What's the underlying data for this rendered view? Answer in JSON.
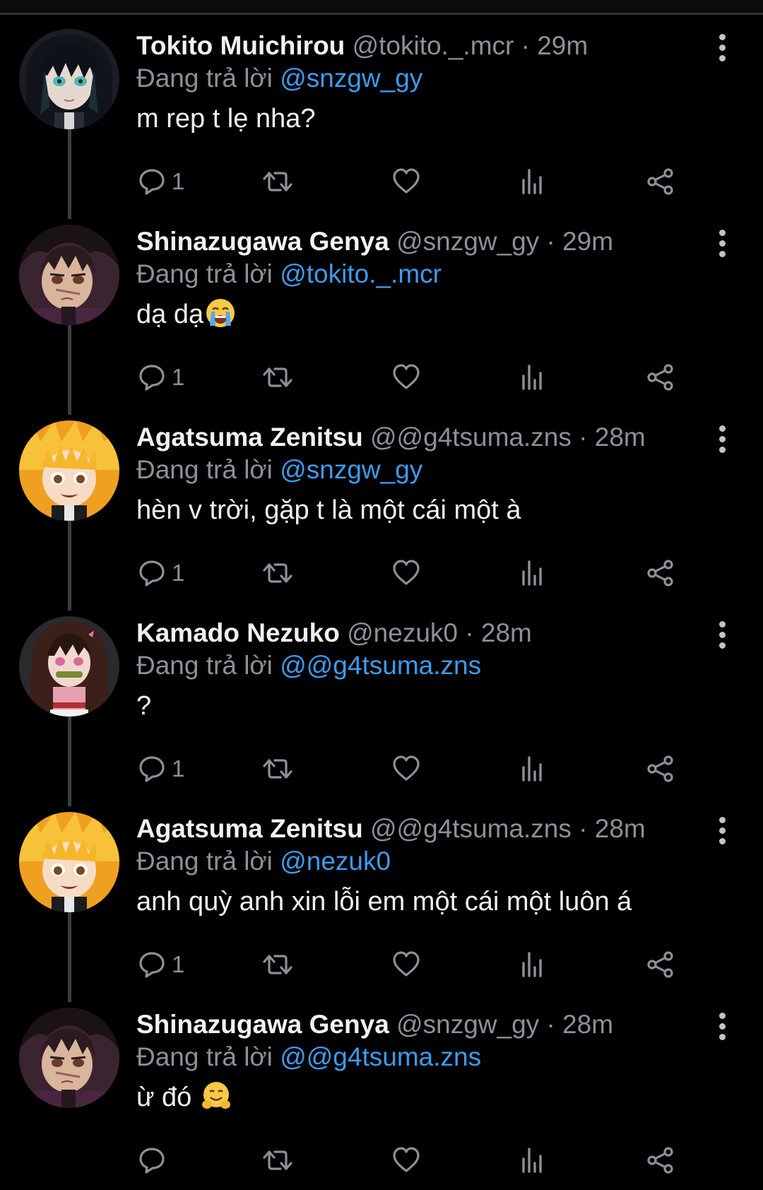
{
  "reply_prefix": "Đang trả lời",
  "colors": {
    "background": "#000000",
    "mention": "#3e9bed",
    "muted": "#8b9198",
    "text": "#f0f0f0",
    "icon": "#8b9198"
  },
  "icons": {
    "reply": "reply-bubble-icon",
    "retweet": "retweet-icon",
    "like": "heart-icon",
    "views": "analytics-bars-icon",
    "share": "share-icon",
    "more": "more-vertical-icon"
  },
  "tweets": [
    {
      "name": "Tokito Muichirou",
      "handle": "@tokito._.mcr",
      "dot": "·",
      "time": "29m",
      "reply_to": "@snzgw_gy",
      "text": "m rep t lẹ nha?",
      "emoji": "",
      "reply_count": "1"
    },
    {
      "name": "Shinazugawa Genya",
      "handle": "@snzgw_gy",
      "dot": "·",
      "time": "29m",
      "reply_to": "@tokito._.mcr",
      "text": "dạ dạ",
      "emoji": "crying-face",
      "reply_count": "1"
    },
    {
      "name": "Agatsuma Zenitsu",
      "handle": "@@g4tsuma.zns",
      "dot": "·",
      "time": "28m",
      "reply_to": "@snzgw_gy",
      "text": "hèn v trời, gặp t là một cái một à",
      "emoji": "",
      "reply_count": "1"
    },
    {
      "name": "Kamado Nezuko",
      "handle": "@nezuk0",
      "dot": "·",
      "time": "28m",
      "reply_to": "@@g4tsuma.zns",
      "text": "?",
      "emoji": "",
      "reply_count": "1"
    },
    {
      "name": "Agatsuma Zenitsu",
      "handle": "@@g4tsuma.zns",
      "dot": "·",
      "time": "28m",
      "reply_to": "@nezuk0",
      "text": "anh quỳ anh xin lỗi em một cái một luôn á",
      "emoji": "",
      "reply_count": "1"
    },
    {
      "name": "Shinazugawa Genya",
      "handle": "@snzgw_gy",
      "dot": "·",
      "time": "28m",
      "reply_to": "@@g4tsuma.zns",
      "text": "ừ đó ",
      "emoji": "hugging-face",
      "reply_count": ""
    }
  ]
}
